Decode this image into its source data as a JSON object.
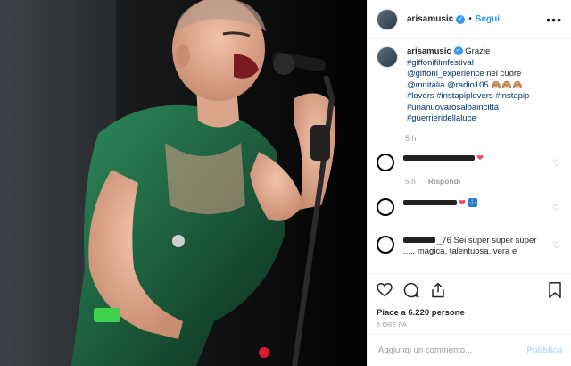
{
  "post": {
    "username": "arisamusic",
    "follow_label": "Segui",
    "separator": "•",
    "more_label": "•••"
  },
  "caption": {
    "username": "arisamusic",
    "text_1": "Grazie",
    "tag_1": "#giffonifilmfestival",
    "tag_2": "@giffoni_experience",
    "text_2": "nel cuore",
    "tag_3": "@mnitalia",
    "tag_4": "@radio105",
    "emoji": "🙈🙈🙈",
    "tag_5": "#lovers",
    "tag_6": "#instapiplovers",
    "tag_7": "#instapip",
    "tag_8": "#unanuovarosalbaincittà",
    "tag_9": "#guerrieridellaluce",
    "time": "5 h"
  },
  "comments": [
    {
      "text": "",
      "emoji": "❤",
      "time": "5 h",
      "reply": "Rispondi"
    },
    {
      "text": "",
      "emoji": "❤",
      "emoji2": "⚓",
      "time": "",
      "reply": ""
    },
    {
      "username": "_76",
      "text": "Sei super super super ..... magica, talentuosa, vera e",
      "time": "",
      "reply": ""
    }
  ],
  "actions": {
    "likes": "Piace a 6.220 persone",
    "posted_ago": "5 ORE FA"
  },
  "add_comment": {
    "placeholder": "Aggiungi un commento...",
    "publish_label": "Pubblica"
  }
}
